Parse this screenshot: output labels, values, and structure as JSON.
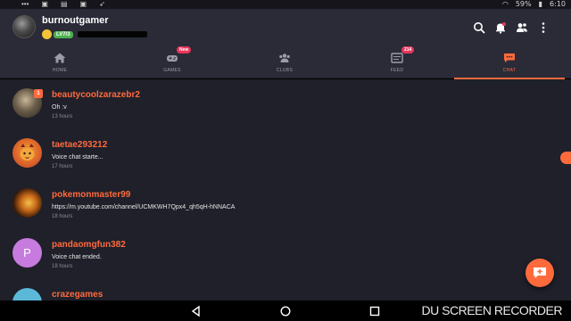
{
  "status_bar": {
    "left_icons": [
      "notification-icon",
      "image-icon",
      "screen-record-icon",
      "gallery-icon",
      "rocket-icon"
    ],
    "battery": "59%",
    "time": "6:10"
  },
  "header": {
    "username": "burnoutgamer",
    "level": "LV7/3"
  },
  "tabs": [
    {
      "label": "HOME",
      "icon": "home-icon",
      "active": false
    },
    {
      "label": "GAMES",
      "icon": "gamepad-icon",
      "active": false,
      "badge": "New"
    },
    {
      "label": "CLUBS",
      "icon": "clubs-icon",
      "active": false
    },
    {
      "label": "FEED",
      "icon": "feed-icon",
      "active": false,
      "badge": "214"
    },
    {
      "label": "CHAT",
      "icon": "chat-icon",
      "active": true
    }
  ],
  "chats": [
    {
      "name": "beautycoolzarazebr2",
      "message": "Oh :v",
      "time": "13 hours",
      "unread": "1"
    },
    {
      "name": "taetae293212",
      "message": "Voice chat starte...",
      "time": "17 hours"
    },
    {
      "name": "pokemonmaster99",
      "message": "https://m.youtube.com/channel/UCMKWH7Qpx4_qh5qH-hNNACA",
      "time": "18 hours"
    },
    {
      "name": "pandaomgfun382",
      "message": "Voice chat ended.",
      "time": "18 hours",
      "initial": "P"
    },
    {
      "name": "crazegames",
      "message": "",
      "time": ""
    }
  ],
  "watermark": "DU SCREEN RECORDER",
  "colors": {
    "accent": "#ff6a3d",
    "header_bg": "#2a2b37",
    "list_bg": "#1f202a",
    "level_badge": "#4caf50",
    "tab_badge": "#e8355b"
  }
}
